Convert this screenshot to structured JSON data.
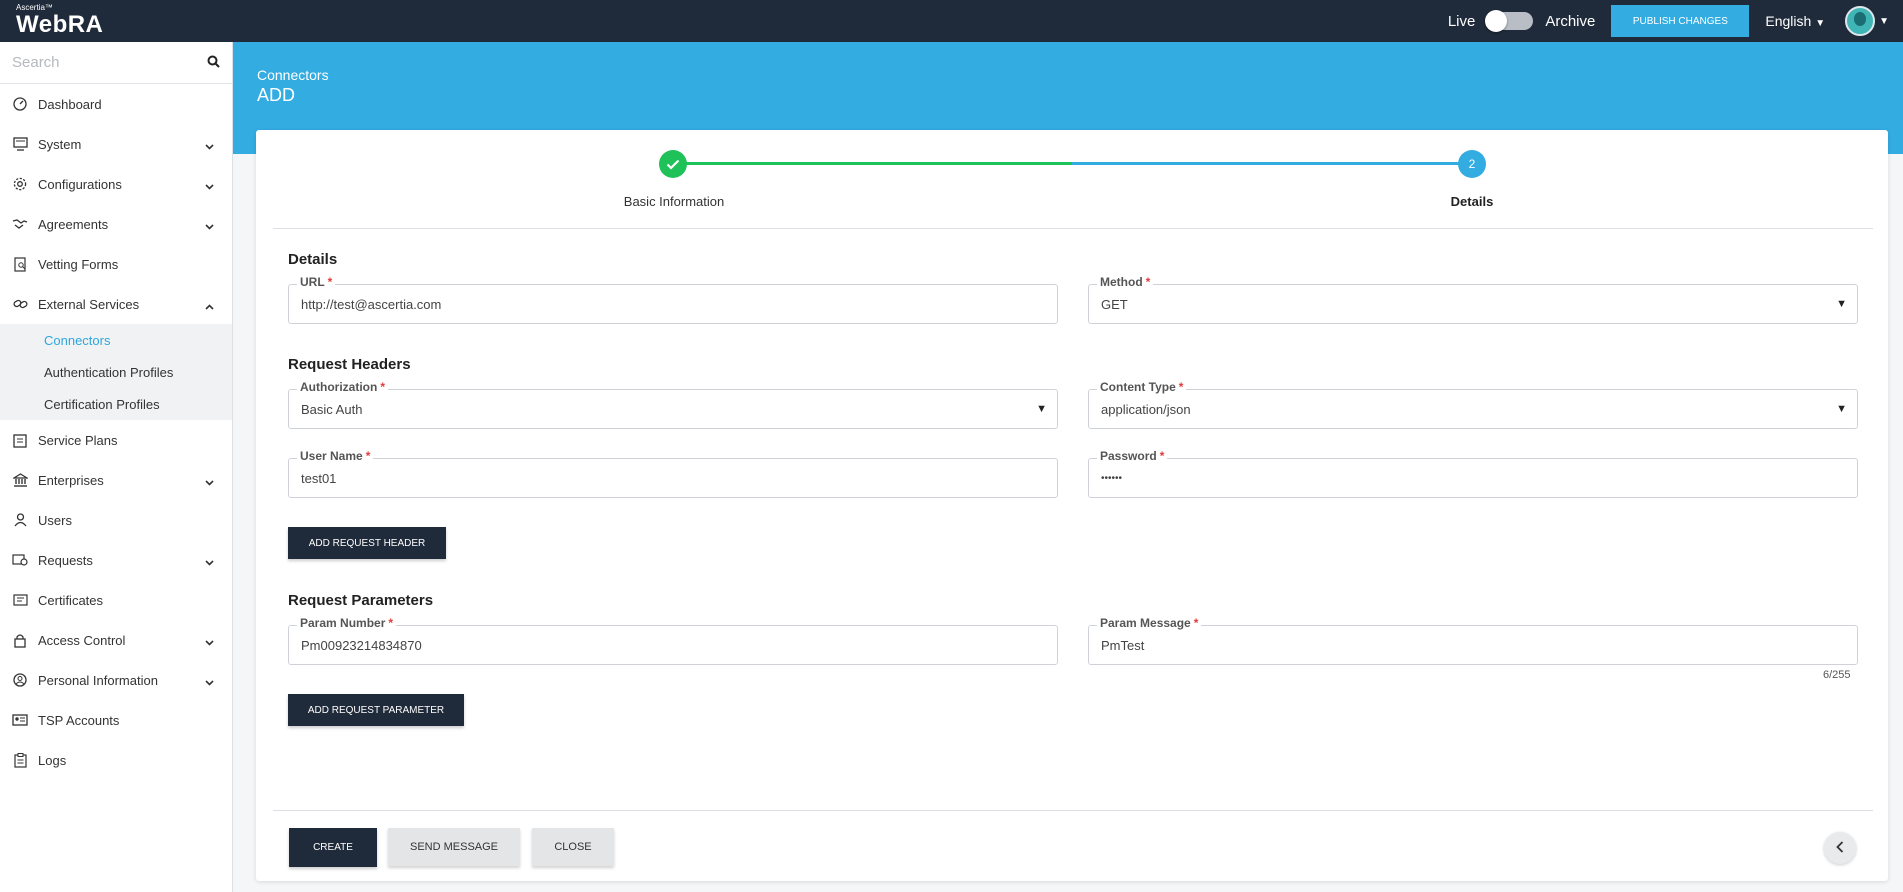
{
  "brand": {
    "small": "Ascertia™",
    "name": "WebRA"
  },
  "topbar": {
    "live_label": "Live",
    "archive_label": "Archive",
    "publish_label": "PUBLISH CHANGES",
    "language": "English"
  },
  "sidebar": {
    "search_placeholder": "Search",
    "items": [
      {
        "label": "Dashboard",
        "icon": "dashboard-icon"
      },
      {
        "label": "System",
        "icon": "system-icon"
      },
      {
        "label": "Configurations",
        "icon": "gear-icon"
      },
      {
        "label": "Agreements",
        "icon": "handshake-icon"
      },
      {
        "label": "Vetting Forms",
        "icon": "vetting-icon"
      },
      {
        "label": "External Services",
        "icon": "link-icon"
      },
      {
        "label": "Service Plans",
        "icon": "plans-icon"
      },
      {
        "label": "Enterprises",
        "icon": "bank-icon"
      },
      {
        "label": "Users",
        "icon": "user-icon"
      },
      {
        "label": "Requests",
        "icon": "requests-icon"
      },
      {
        "label": "Certificates",
        "icon": "certificate-icon"
      },
      {
        "label": "Access Control",
        "icon": "lock-icon"
      },
      {
        "label": "Personal Information",
        "icon": "person-circle-icon"
      },
      {
        "label": "TSP Accounts",
        "icon": "id-card-icon"
      },
      {
        "label": "Logs",
        "icon": "logs-icon"
      }
    ],
    "sub_items": [
      {
        "label": "Connectors"
      },
      {
        "label": "Authentication Profiles"
      },
      {
        "label": "Certification Profiles"
      }
    ]
  },
  "header": {
    "breadcrumb": "Connectors",
    "title": "ADD"
  },
  "stepper": {
    "step1_label": "Basic Information",
    "step2_number": "2",
    "step2_label": "Details"
  },
  "details": {
    "title": "Details",
    "url_label": "URL",
    "url_value": "http://test@ascertia.com",
    "method_label": "Method",
    "method_value": "GET"
  },
  "headers": {
    "title": "Request Headers",
    "authorization_label": "Authorization",
    "authorization_value": "Basic Auth",
    "content_type_label": "Content Type",
    "content_type_value": "application/json",
    "username_label": "User Name",
    "username_value": "test01",
    "password_label": "Password",
    "password_value": "••••••",
    "add_header_label": "ADD REQUEST HEADER"
  },
  "params": {
    "title": "Request Parameters",
    "number_label": "Param Number",
    "number_value": "Pm00923214834870",
    "message_label": "Param Message",
    "message_value": "PmTest",
    "char_counter": "6/255",
    "add_param_label": "ADD REQUEST PARAMETER"
  },
  "actions": {
    "create_label": "CREATE",
    "send_label": "SEND MESSAGE",
    "close_label": "CLOSE"
  },
  "required_mark": "*",
  "colors": {
    "navy": "#1f2a3a",
    "accent": "#33ace2",
    "success": "#1ec258",
    "required": "#e03b3b"
  }
}
